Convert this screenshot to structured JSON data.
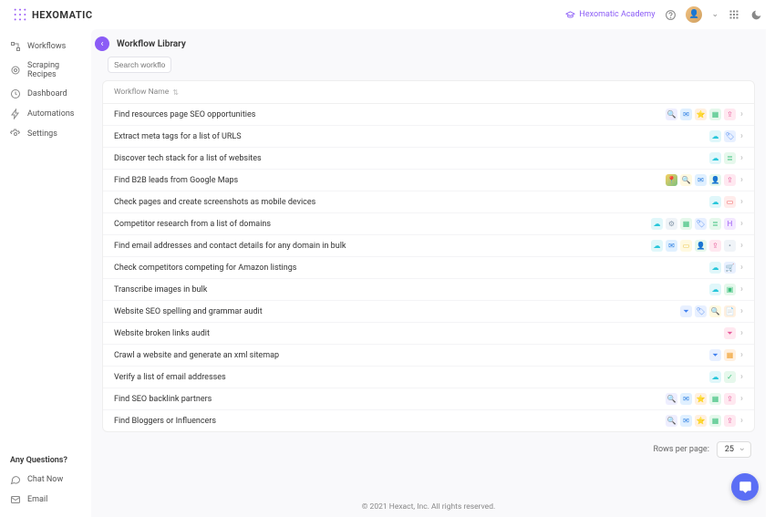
{
  "brand": "HEXOMATIC",
  "header": {
    "academy": "Hexomatic Academy"
  },
  "sidebar": {
    "items": [
      {
        "label": "Workflows"
      },
      {
        "label": "Scraping Recipes"
      },
      {
        "label": "Dashboard"
      },
      {
        "label": "Automations"
      },
      {
        "label": "Settings"
      }
    ],
    "questions": "Any Questions?",
    "chat": "Chat Now",
    "email": "Email"
  },
  "page": {
    "title": "Workflow Library",
    "search_placeholder": "Search workflow tem",
    "col_name": "Workflow Name"
  },
  "rows": [
    {
      "name": "Find resources page SEO opportunities",
      "icons": [
        "search",
        "mail",
        "star",
        "grid",
        "share"
      ]
    },
    {
      "name": "Extract meta tags for a list of URLS",
      "icons": [
        "cloud",
        "tag"
      ]
    },
    {
      "name": "Discover tech stack for a list of websites",
      "icons": [
        "cloud",
        "stack"
      ]
    },
    {
      "name": "Find B2B leads from Google Maps",
      "icons": [
        "map",
        "search-y",
        "mail",
        "user",
        "share"
      ]
    },
    {
      "name": "Check pages and create screenshots as mobile devices",
      "icons": [
        "cloud",
        "mobile"
      ]
    },
    {
      "name": "Competitor research from a list of domains",
      "icons": [
        "cloud",
        "gear",
        "grid",
        "tag",
        "stack",
        "h"
      ]
    },
    {
      "name": "Find email addresses and contact details for any domain in bulk",
      "icons": [
        "cloud",
        "mail",
        "card",
        "user",
        "share",
        "dot"
      ]
    },
    {
      "name": "Check competitors competing for Amazon listings",
      "icons": [
        "cloud",
        "cart"
      ]
    },
    {
      "name": "Transcribe images in bulk",
      "icons": [
        "cloud",
        "img"
      ]
    },
    {
      "name": "Website SEO spelling and grammar audit",
      "icons": [
        "filter",
        "tag",
        "search-y",
        "doc"
      ]
    },
    {
      "name": "Website broken links audit",
      "icons": [
        "filter-r"
      ]
    },
    {
      "name": "Crawl a website and generate an xml sitemap",
      "icons": [
        "filter",
        "cal"
      ]
    },
    {
      "name": "Verify a list of email addresses",
      "icons": [
        "cloud",
        "check"
      ]
    },
    {
      "name": "Find SEO backlink partners",
      "icons": [
        "search",
        "mail",
        "star",
        "grid",
        "share"
      ]
    },
    {
      "name": "Find Bloggers or Influencers",
      "icons": [
        "search",
        "mail",
        "star",
        "grid",
        "share"
      ]
    }
  ],
  "pager": {
    "label": "Rows per page:",
    "value": "25"
  },
  "footer": "© 2021 Hexact, Inc. All rights reserved."
}
